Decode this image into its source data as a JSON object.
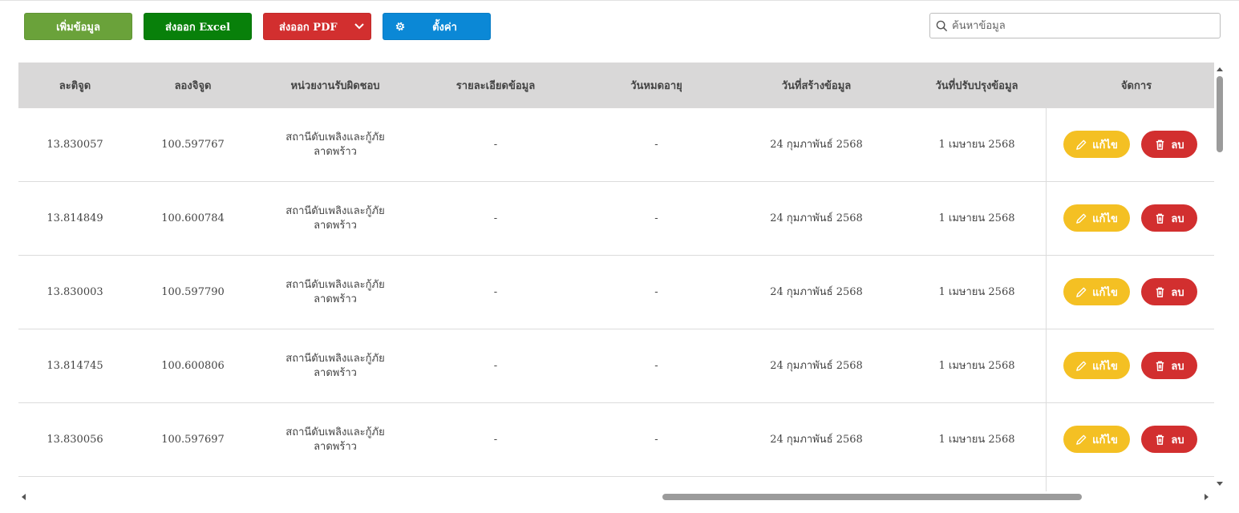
{
  "toolbar": {
    "add_label": "เพิ่มข้อมูล",
    "excel_label": "ส่งออก Excel",
    "pdf_label": "ส่งออก PDF",
    "settings_label": "ตั้งค่า",
    "search_placeholder": "ค้นหาข้อมูล",
    "colors": {
      "add": "#6aa23a",
      "excel": "#08800a",
      "pdf": "#d22f2f",
      "settings": "#0b88d6"
    }
  },
  "table": {
    "headers": [
      "ละติจูด",
      "ลองจิจูด",
      "หน่วยงานรับผิดชอบ",
      "รายละเอียดข้อมูล",
      "วันหมดอายุ",
      "วันที่สร้างข้อมูล",
      "วันที่ปรับปรุงข้อมูล",
      "จัดการ"
    ],
    "rows": [
      {
        "lat": "13.830057",
        "lng": "100.597767",
        "unit_line1": "สถานีดับเพลิงและกู้ภัย",
        "unit_line2": "ลาดพร้าว",
        "detail": "-",
        "expire": "-",
        "created": "24 กุมภาพันธ์ 2568",
        "updated": "1 เมษายน 2568"
      },
      {
        "lat": "13.814849",
        "lng": "100.600784",
        "unit_line1": "สถานีดับเพลิงและกู้ภัย",
        "unit_line2": "ลาดพร้าว",
        "detail": "-",
        "expire": "-",
        "created": "24 กุมภาพันธ์ 2568",
        "updated": "1 เมษายน 2568"
      },
      {
        "lat": "13.830003",
        "lng": "100.597790",
        "unit_line1": "สถานีดับเพลิงและกู้ภัย",
        "unit_line2": "ลาดพร้าว",
        "detail": "-",
        "expire": "-",
        "created": "24 กุมภาพันธ์ 2568",
        "updated": "1 เมษายน 2568"
      },
      {
        "lat": "13.814745",
        "lng": "100.600806",
        "unit_line1": "สถานีดับเพลิงและกู้ภัย",
        "unit_line2": "ลาดพร้าว",
        "detail": "-",
        "expire": "-",
        "created": "24 กุมภาพันธ์ 2568",
        "updated": "1 เมษายน 2568"
      },
      {
        "lat": "13.830056",
        "lng": "100.597697",
        "unit_line1": "สถานีดับเพลิงและกู้ภัย",
        "unit_line2": "ลาดพร้าว",
        "detail": "-",
        "expire": "-",
        "created": "24 กุมภาพันธ์ 2568",
        "updated": "1 เมษายน 2568"
      }
    ],
    "actions": {
      "edit_label": "แก้ไข",
      "delete_label": "ลบ",
      "edit_color": "#f4c023",
      "delete_color": "#d22f2f"
    }
  }
}
